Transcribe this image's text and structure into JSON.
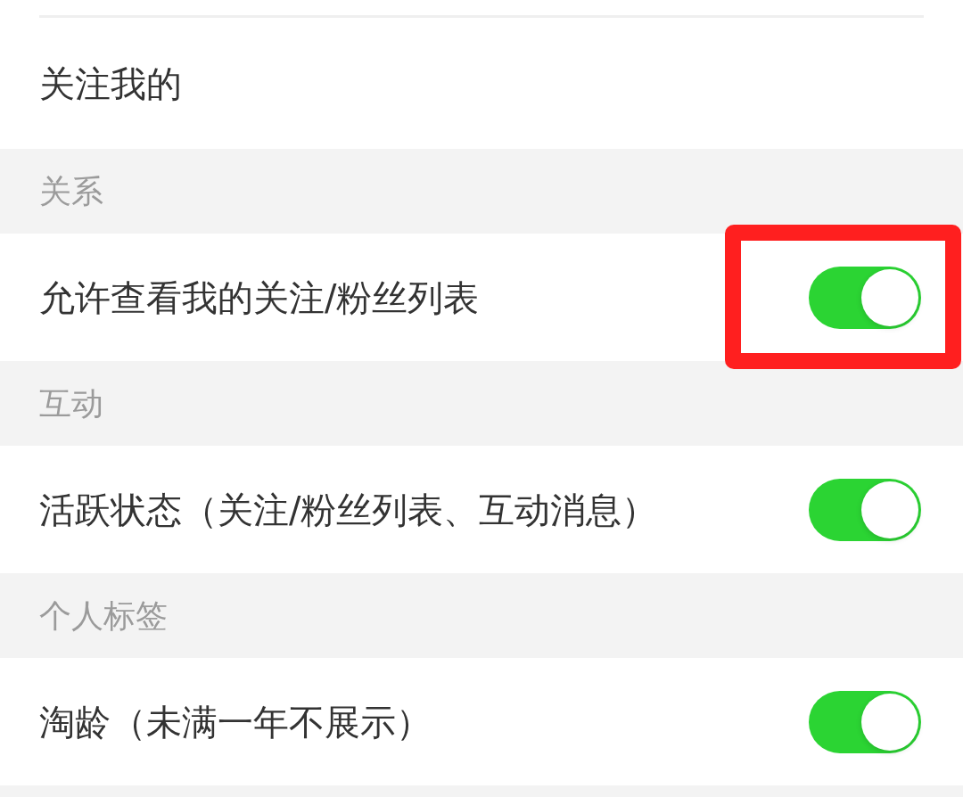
{
  "sections": [
    {
      "rows": [
        {
          "kind": "link",
          "label": "关注我的",
          "highlighted": false
        }
      ]
    },
    {
      "header": "关系",
      "rows": [
        {
          "kind": "toggle",
          "label": "允许查看我的关注/粉丝列表",
          "on": true,
          "highlighted": true
        }
      ]
    },
    {
      "header": "互动",
      "rows": [
        {
          "kind": "toggle",
          "label": "活跃状态（关注/粉丝列表、互动消息）",
          "on": true,
          "highlighted": false
        }
      ]
    },
    {
      "header": "个人标签",
      "rows": [
        {
          "kind": "toggle",
          "label": "淘龄（未满一年不展示）",
          "on": true,
          "highlighted": false
        }
      ]
    }
  ]
}
